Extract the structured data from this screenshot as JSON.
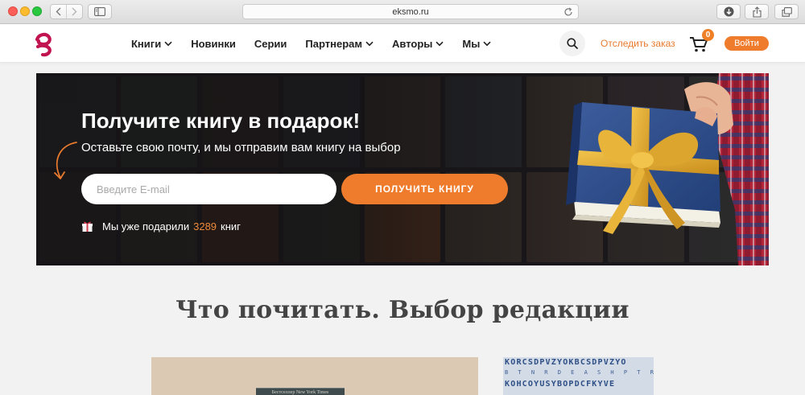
{
  "browser": {
    "url": "eksmo.ru"
  },
  "header": {
    "menu": [
      {
        "label": "Книги",
        "has_dropdown": true
      },
      {
        "label": "Новинки",
        "has_dropdown": false
      },
      {
        "label": "Серии",
        "has_dropdown": false
      },
      {
        "label": "Партнерам",
        "has_dropdown": true
      },
      {
        "label": "Авторы",
        "has_dropdown": true
      },
      {
        "label": "Мы",
        "has_dropdown": true
      }
    ],
    "track_order_label": "Отследить заказ",
    "cart_count": "0",
    "login_label": "Войти"
  },
  "banner": {
    "title": "Получите книгу в подарок!",
    "subtitle": "Оставьте свою почту, и мы отправим вам книгу на выбор",
    "email_placeholder": "Введите E-mail",
    "cta_label": "ПОЛУЧИТЬ КНИГУ",
    "counter_prefix": "Мы уже подарили",
    "counter_value": "3289",
    "counter_suffix": "книг"
  },
  "editorial": {
    "title": "Что почитать. Выбор редакции",
    "card1_book_text": "Бестселлер New York Times",
    "card2_letter_rows": [
      "KORCSDPVZYOKBCSDPVZYO",
      "B T N R D E A S H P T R K",
      "KOHCOYUSYBOPDCFKYVE"
    ]
  },
  "colors": {
    "accent": "#ef7c2c",
    "logo": "#c0134f",
    "banner_bg": "#1c1a1c",
    "gift_box": "#2f4f8c",
    "ribbon": "#e2ad32"
  },
  "icons": [
    "back-icon",
    "forward-icon",
    "sidebar-icon",
    "reload-icon",
    "download-icon",
    "share-icon",
    "tabs-icon",
    "eksmo-logo-icon",
    "search-icon",
    "cart-icon",
    "arrow-icon",
    "gift-icon"
  ]
}
